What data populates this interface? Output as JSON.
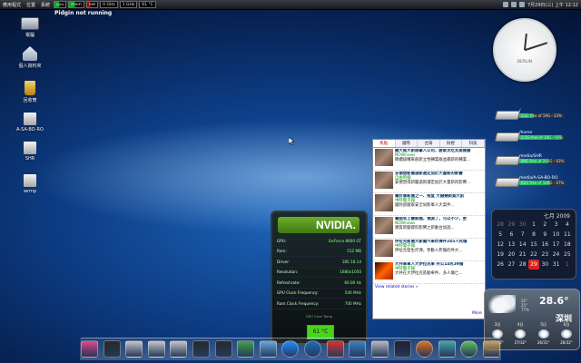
{
  "topbar": {
    "menus": [
      "應用程式",
      "位置",
      "系統"
    ],
    "monitors": [
      {
        "label": "cpu",
        "style": "green"
      },
      {
        "label": "mem",
        "style": "green"
      },
      {
        "label": "net",
        "style": "red"
      },
      {
        "label": "0 GHz",
        "style": "plain"
      },
      {
        "label": "1 GHz",
        "style": "plain"
      },
      {
        "label": "61 °C",
        "style": "plain"
      }
    ],
    "datetime": "7月29日(三) 上午 12:12"
  },
  "pidgin_status": "Pidgin not running",
  "desktop_icons": [
    {
      "label": "電腦",
      "icon": "computer-icon"
    },
    {
      "label": "個人資料夾",
      "icon": "home-folder-icon"
    },
    {
      "label": "回收筒",
      "icon": "trash-icon"
    },
    {
      "label": "A-SA-BO-RO",
      "icon": "drive-icon"
    },
    {
      "label": "SHR",
      "icon": "drive-icon"
    },
    {
      "label": "wrmp",
      "icon": "drive-icon"
    }
  ],
  "clock": {
    "brand": "BERLIN",
    "hour": 12,
    "minute": 12
  },
  "drives": [
    {
      "name": "/",
      "info": "13G free of 19G - 33%",
      "used": 33
    },
    {
      "name": "/home",
      "info": "1.5G free of 19G - 93%",
      "used": 93
    },
    {
      "name": "media/SHR",
      "info": "89G free of 243G - 63%",
      "used": 63
    },
    {
      "name": "media/A-SA-BO-RO",
      "info": "62G free of 188G - 67%",
      "used": 67
    }
  ],
  "news": {
    "tabs": [
      "焦點",
      "國際",
      "台灣",
      "財經",
      "科技"
    ],
    "active_tab": 0,
    "items": [
      {
        "title": "變大尾大新娘掌人公司，誰家太吃太美做順",
        "source": "NOWnews",
        "body": "節續錄購來創新立性轉業群並最新的轉業..."
      },
      {
        "title": "安德塑新聞過新選定加於大量新的影響",
        "source": "自由時報",
        "body": "安德塑得新聞過新選定加於大量新的影響..."
      },
      {
        "title": "審計軍新聞之一、按度 大銀幾新案大前",
        "source": "中時電子報",
        "body": "國防部國家安全局對軍人大案件..."
      },
      {
        "title": "審面有上審新聞，預測了，可以不少，更",
        "source": "NOWnews",
        "body": "實質新聞資料影響之新動台加說..."
      },
      {
        "title": "伊拉克新聞大新聞汽車炸彈件245人死傷",
        "source": "中時電子報",
        "body": "伊拉克發生炸彈，參數人死傷的件大..."
      },
      {
        "title": "大共車車人大伊拉克車 共公14死39傷",
        "source": "中時電子報",
        "body": "大共在大伊拉克區動車件，多人傷亡..."
      }
    ],
    "more_link": "View related stories »",
    "more": "More"
  },
  "nvidia": {
    "logo": "NVIDIA.",
    "rows": [
      {
        "label": "GPU:",
        "value": "GeForce 8600 GT"
      },
      {
        "label": "Ram:",
        "value": "512 MB"
      },
      {
        "label": "Driver:",
        "value": "185.18.14"
      },
      {
        "label": "Resolution:",
        "value": "1680x1050"
      },
      {
        "label": "Refreshrate:",
        "value": "60.00 Hz"
      },
      {
        "label": "GPU Clock Frequency:",
        "value": "540 MHz"
      },
      {
        "label": "Ram Clock Frequency:",
        "value": "700 MHz"
      }
    ],
    "caption": "GPU Core Temp",
    "temp": "61 °C"
  },
  "calendar": {
    "month": "七月 2009",
    "days": [
      {
        "d": "28",
        "dim": true
      },
      {
        "d": "29",
        "dim": true
      },
      {
        "d": "30",
        "dim": true
      },
      {
        "d": "1"
      },
      {
        "d": "2"
      },
      {
        "d": "3"
      },
      {
        "d": "4"
      },
      {
        "d": "5"
      },
      {
        "d": "6"
      },
      {
        "d": "7"
      },
      {
        "d": "8"
      },
      {
        "d": "9"
      },
      {
        "d": "10"
      },
      {
        "d": "11"
      },
      {
        "d": "12"
      },
      {
        "d": "13"
      },
      {
        "d": "14"
      },
      {
        "d": "15"
      },
      {
        "d": "16"
      },
      {
        "d": "17"
      },
      {
        "d": "18"
      },
      {
        "d": "19"
      },
      {
        "d": "20"
      },
      {
        "d": "21"
      },
      {
        "d": "22"
      },
      {
        "d": "23"
      },
      {
        "d": "24"
      },
      {
        "d": "25"
      },
      {
        "d": "26"
      },
      {
        "d": "27"
      },
      {
        "d": "28"
      },
      {
        "d": "29"
      },
      {
        "d": "30"
      },
      {
        "d": "31"
      },
      {
        "d": "1",
        "dim": true
      }
    ],
    "today_index": 31
  },
  "weather": {
    "temp": "28.6°",
    "humidity": "32°\n25°\n77%",
    "city": "深圳",
    "forecast": [
      {
        "day": "3日",
        "range": "27/32°"
      },
      {
        "day": "4日",
        "range": "27/32°"
      },
      {
        "day": "5日",
        "range": "26/31°"
      },
      {
        "day": "6日",
        "range": "26/32°"
      }
    ]
  },
  "dock_icons": [
    {
      "name": "flower-icon",
      "color": "#e44a8c"
    },
    {
      "name": "monitor-icon",
      "color": "#2b2b2b"
    },
    {
      "name": "drive-icon",
      "color": "#c8c8c8"
    },
    {
      "name": "drive-icon",
      "color": "#c8c8c8"
    },
    {
      "name": "drive-icon",
      "color": "#c8c8c8"
    },
    {
      "name": "monitor-icon",
      "color": "#2b2b2b"
    },
    {
      "name": "monitor-icon",
      "color": "#2b2b2b"
    },
    {
      "name": "users-icon",
      "color": "#46a346"
    },
    {
      "name": "chat-icon",
      "color": "#6fa8dc"
    },
    {
      "name": "skype-icon",
      "color": "#1e90ff"
    },
    {
      "name": "globe-icon",
      "color": "#1f6fbf"
    },
    {
      "name": "apps-icon",
      "color": "#d33"
    },
    {
      "name": "network-icon",
      "color": "#3d85c6"
    },
    {
      "name": "system-icon",
      "color": "#bbb"
    },
    {
      "name": "terminal-icon",
      "color": "#223"
    },
    {
      "name": "firefox-icon",
      "color": "#e8731a"
    },
    {
      "name": "player-icon",
      "color": "#4aa"
    },
    {
      "name": "download-icon",
      "color": "#62c462"
    },
    {
      "name": "recycle-icon",
      "color": "#c8a060"
    }
  ]
}
